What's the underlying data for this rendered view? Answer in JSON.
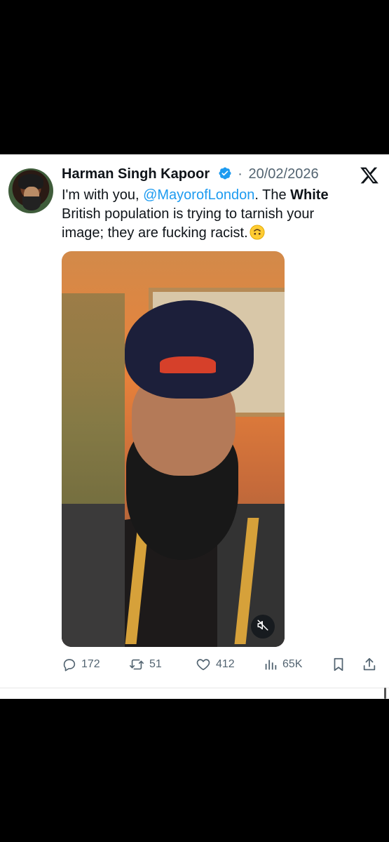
{
  "tweet": {
    "author_name": "Harman Singh Kapoor",
    "separator": "·",
    "date": "20/02/2026",
    "text_prefix": "I'm with you, ",
    "mention": "@MayorofLondon",
    "text_middle": ". The ",
    "text_bold": "White",
    "text_suffix": " British population is trying to tarnish your image; they are fucking racist."
  },
  "actions": {
    "replies": "172",
    "reposts": "51",
    "likes": "412",
    "views": "65K"
  },
  "colors": {
    "accent": "#1d9bf0",
    "text": "#0f1419",
    "muted": "#536471",
    "background": "#ffffff"
  },
  "icons": [
    "x-logo-icon",
    "verified-badge-icon",
    "upside-down-face-icon",
    "mute-icon",
    "reply-icon",
    "repost-icon",
    "like-icon",
    "views-icon",
    "bookmark-icon",
    "share-icon"
  ]
}
